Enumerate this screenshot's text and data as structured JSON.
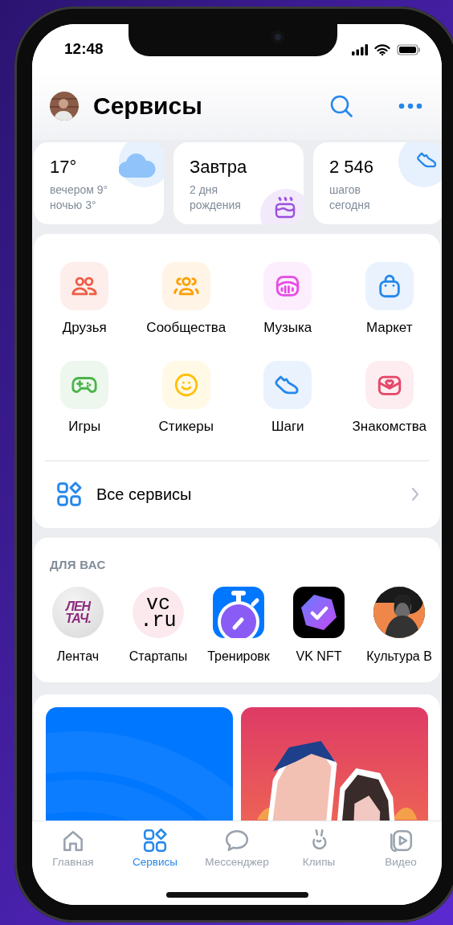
{
  "status_bar": {
    "time": "12:48"
  },
  "header": {
    "title": "Сервисы"
  },
  "widgets": [
    {
      "kind": "weather",
      "title": "17°",
      "lines": [
        "вечером 9°",
        "ночью 3°"
      ]
    },
    {
      "kind": "birthday",
      "title": "Завтра",
      "lines": [
        "2 дня",
        "рождения"
      ]
    },
    {
      "kind": "steps",
      "title": "2 546",
      "lines": [
        "шагов",
        "сегодня"
      ]
    }
  ],
  "services": [
    {
      "kind": "friends",
      "label": "Друзья"
    },
    {
      "kind": "communities",
      "label": "Сообщества"
    },
    {
      "kind": "music",
      "label": "Музыка"
    },
    {
      "kind": "market",
      "label": "Маркет"
    },
    {
      "kind": "games",
      "label": "Игры"
    },
    {
      "kind": "stickers",
      "label": "Стикеры"
    },
    {
      "kind": "steps",
      "label": "Шаги"
    },
    {
      "kind": "dating",
      "label": "Знакомства"
    }
  ],
  "all_services": {
    "label": "Все сервисы"
  },
  "for_you": {
    "title": "ДЛЯ ВАС",
    "items": [
      {
        "kind": "italic-logo",
        "logo": [
          "ЛЕН",
          "ТАЧ."
        ],
        "label": "Лентач"
      },
      {
        "kind": "mono-logo",
        "logo": [
          "vc",
          ".ru"
        ],
        "label": "Стартапы"
      },
      {
        "kind": "stopwatch",
        "label": "Тренировк"
      },
      {
        "kind": "nft",
        "label": "VK NFT"
      },
      {
        "kind": "picture",
        "label": "Культура В"
      }
    ]
  },
  "tab_bar": [
    {
      "kind": "home",
      "label": "Главная",
      "selected": false
    },
    {
      "kind": "services",
      "label": "Сервисы",
      "selected": true
    },
    {
      "kind": "messenger",
      "label": "Мессенджер",
      "selected": false
    },
    {
      "kind": "clips",
      "label": "Клипы",
      "selected": false
    },
    {
      "kind": "video",
      "label": "Видео",
      "selected": false
    }
  ]
}
